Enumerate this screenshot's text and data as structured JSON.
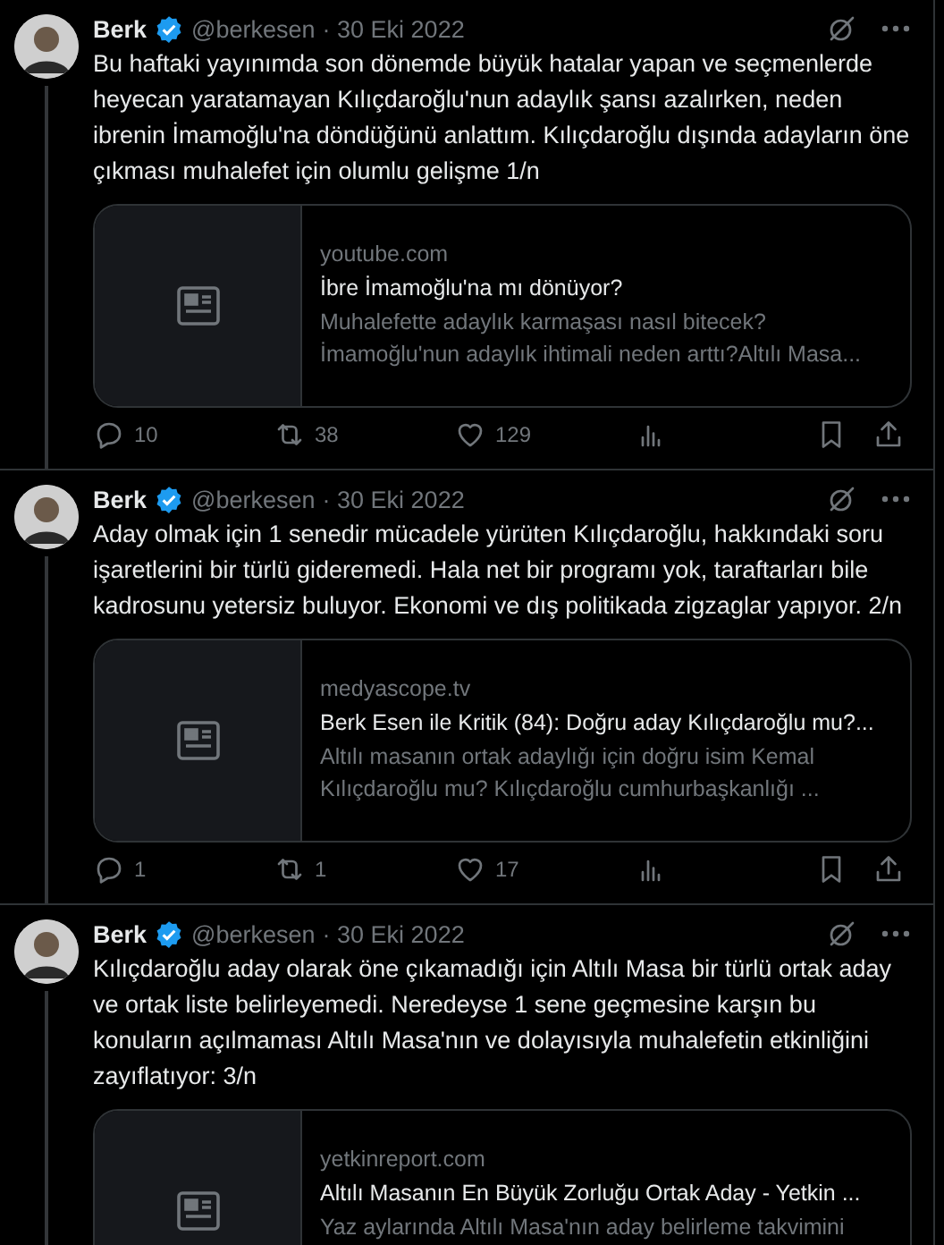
{
  "tweets": [
    {
      "name": "Berk",
      "handle": "@berkesen",
      "date": "· 30 Eki 2022",
      "verified": true,
      "thread_line": true,
      "text": "Bu haftaki yayınımda son dönemde büyük hatalar yapan ve seçmenlerde heyecan yaratamayan Kılıçdaroğlu'nun adaylık şansı azalırken, neden ibrenin İmamoğlu'na döndüğünü anlattım. Kılıçdaroğlu dışında adayların öne çıkması muhalefet için olumlu gelişme 1/n",
      "card": {
        "domain": "youtube.com",
        "title": "İbre İmamoğlu'na mı dönüyor?",
        "description": "Muhalefette adaylık karmaşası nasıl bitecek? İmamoğlu'nun adaylık ihtimali neden arttı?Altılı Masa..."
      },
      "actions": {
        "replies": "10",
        "reposts": "38",
        "likes": "129"
      }
    },
    {
      "name": "Berk",
      "handle": "@berkesen",
      "date": "· 30 Eki 2022",
      "verified": true,
      "thread_line": true,
      "text": "Aday olmak için 1 senedir mücadele yürüten Kılıçdaroğlu, hakkındaki soru işaretlerini bir türlü gideremedi. Hala net bir programı yok, taraftarları bile kadrosunu yetersiz buluyor. Ekonomi ve dış politikada zigzaglar yapıyor. 2/n",
      "card": {
        "domain": "medyascope.tv",
        "title": "Berk Esen ile Kritik (84): Doğru aday Kılıçdaroğlu mu?...",
        "description": "Altılı masanın ortak adaylığı için doğru isim Kemal Kılıçdaroğlu mu? Kılıçdaroğlu cumhurbaşkanlığı ..."
      },
      "actions": {
        "replies": "1",
        "reposts": "1",
        "likes": "17"
      }
    },
    {
      "name": "Berk",
      "handle": "@berkesen",
      "date": "· 30 Eki 2022",
      "verified": true,
      "thread_line": true,
      "text": "Kılıçdaroğlu aday olarak öne çıkamadığı için Altılı Masa bir türlü ortak aday ve ortak liste belirleyemedi. Neredeyse 1 sene geçmesine karşın bu konuların açılmaması Altılı Masa'nın ve dolayısıyla muhalefetin etkinliğini zayıflatıyor: 3/n",
      "card": {
        "domain": "yetkinreport.com",
        "title": "Altılı Masanın En Büyük Zorluğu Ortak Aday - Yetkin ...",
        "description": "Yaz aylarında Altılı Masa'nın aday belirleme takvimini"
      }
    }
  ]
}
